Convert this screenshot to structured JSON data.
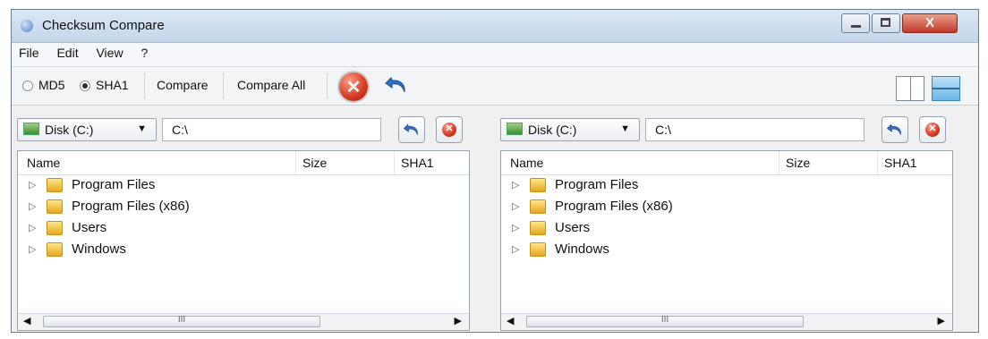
{
  "window": {
    "title": "Checksum Compare",
    "close_label": "X"
  },
  "menu": [
    "File",
    "Edit",
    "View",
    "?"
  ],
  "toolbar": {
    "md5_label": "MD5",
    "sha1_label": "SHA1",
    "selected_algorithm": "SHA1",
    "compare_label": "Compare",
    "compare_all_label": "Compare All"
  },
  "left_panel": {
    "drive": "Disk (C:)",
    "path": "C:\\",
    "columns": [
      "Name",
      "Size",
      "SHA1"
    ],
    "items": [
      "Program Files",
      "Program Files (x86)",
      "Users",
      "Windows"
    ],
    "scroll_grip": "III"
  },
  "right_panel": {
    "drive": "Disk (C:)",
    "path": "C:\\",
    "columns": [
      "Name",
      "Size",
      "SHA1"
    ],
    "items": [
      "Program Files",
      "Program Files (x86)",
      "Users",
      "Windows"
    ],
    "scroll_grip": "III"
  }
}
